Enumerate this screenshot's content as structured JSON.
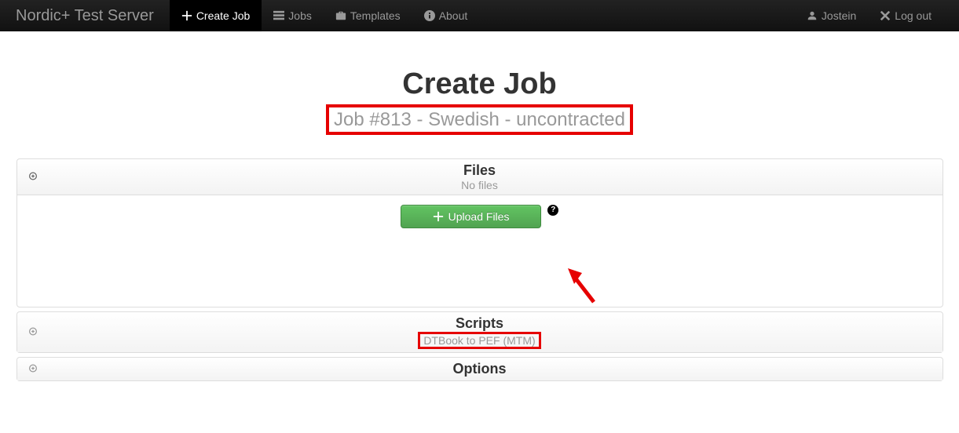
{
  "navbar": {
    "brand": "Nordic+ Test Server",
    "items": [
      {
        "label": "Create Job"
      },
      {
        "label": "Jobs"
      },
      {
        "label": "Templates"
      },
      {
        "label": "About"
      }
    ],
    "user": "Jostein",
    "logout": "Log out"
  },
  "page": {
    "title": "Create Job",
    "subtitle": "Job #813 - Swedish - uncontracted"
  },
  "panels": {
    "files": {
      "title": "Files",
      "status": "No files",
      "upload_label": "Upload Files"
    },
    "scripts": {
      "title": "Scripts",
      "selected": "DTBook to PEF (MTM)"
    },
    "options": {
      "title": "Options"
    }
  }
}
